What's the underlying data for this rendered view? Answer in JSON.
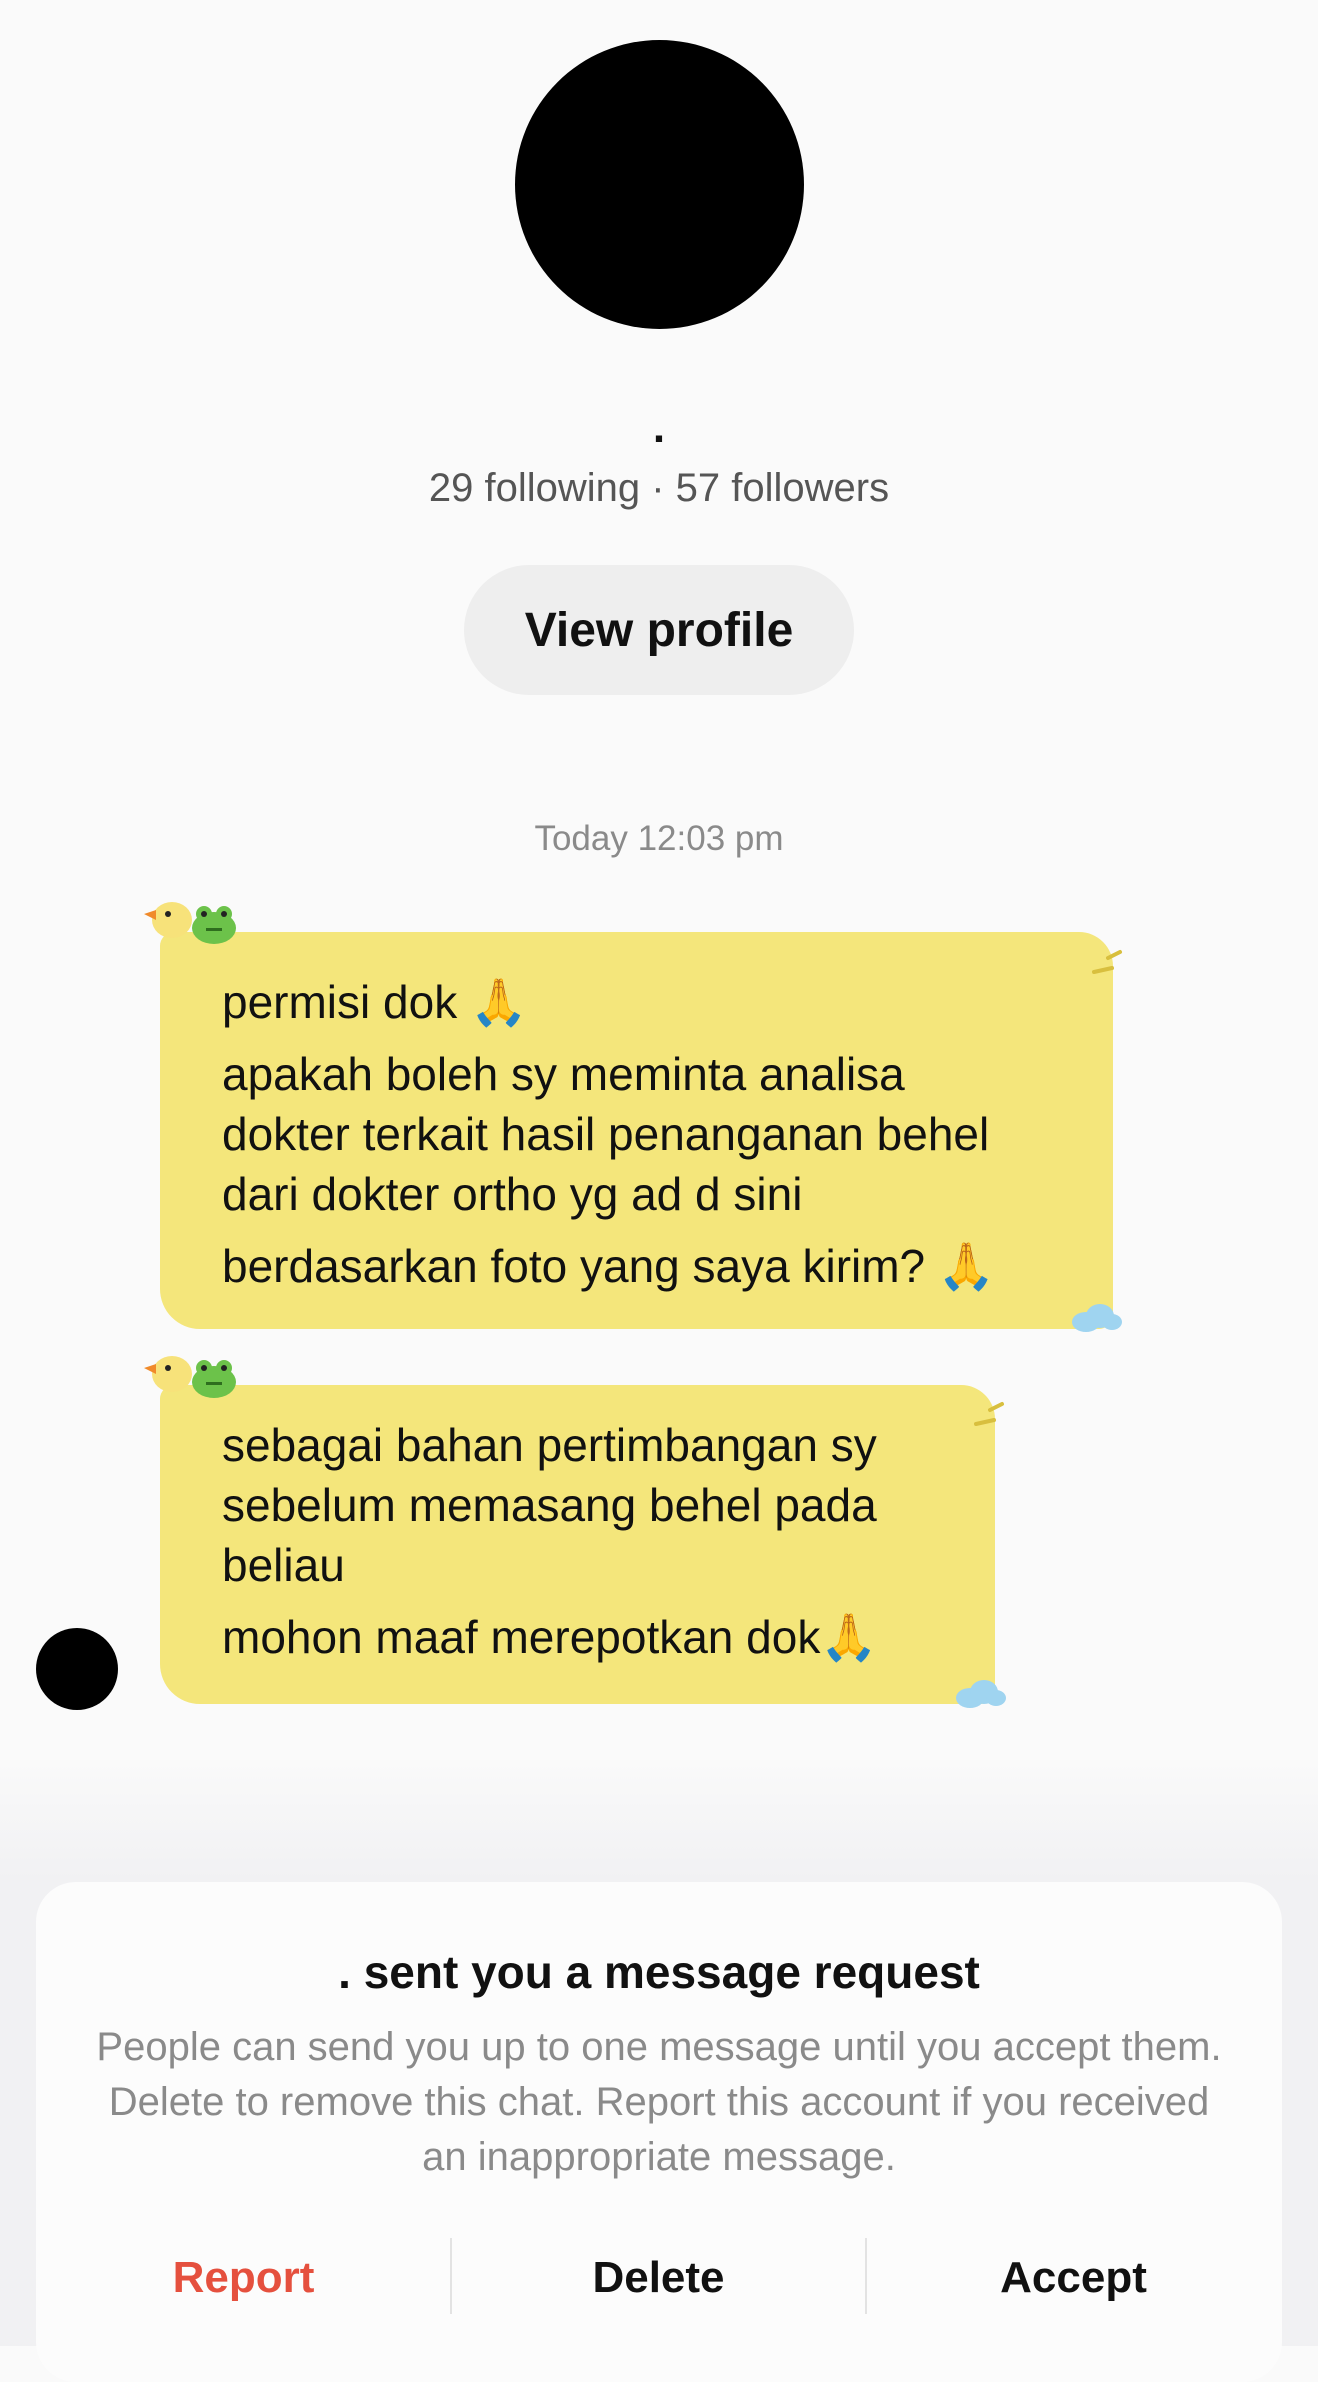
{
  "profile": {
    "username": ".",
    "stats": "29 following · 57 followers",
    "view_profile_label": "View profile"
  },
  "chat": {
    "timestamp": "Today 12:03 pm",
    "messages": [
      {
        "lines": [
          "permisi dok 🙏",
          "apakah boleh sy meminta analisa",
          "dokter terkait hasil penanganan behel",
          "dari dokter ortho yg ad d sini",
          "berdasarkan foto yang saya kirim? 🙏"
        ]
      },
      {
        "lines": [
          "sebagai bahan pertimbangan sy",
          "sebelum memasang behel pada",
          "beliau",
          "mohon maaf merepotkan dok🙏"
        ]
      }
    ],
    "bubble_color": "#f4e67b"
  },
  "request": {
    "title": ". sent you a message request",
    "description": "People can send you up to one message until you accept them. Delete to remove this chat. Report this account if you received an inappropriate message.",
    "report_label": "Report",
    "delete_label": "Delete",
    "accept_label": "Accept",
    "report_color": "#e5503e"
  }
}
